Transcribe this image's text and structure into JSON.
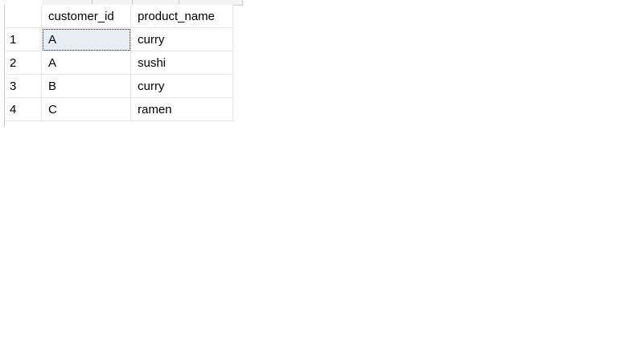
{
  "results_grid": {
    "columns": [
      "customer_id",
      "product_name"
    ],
    "rows": [
      {
        "num": "1",
        "customer_id": "A",
        "product_name": "curry"
      },
      {
        "num": "2",
        "customer_id": "A",
        "product_name": "sushi"
      },
      {
        "num": "3",
        "customer_id": "B",
        "product_name": "curry"
      },
      {
        "num": "4",
        "customer_id": "C",
        "product_name": "ramen"
      }
    ],
    "selected_cell": {
      "row": 1,
      "column": "customer_id"
    }
  }
}
